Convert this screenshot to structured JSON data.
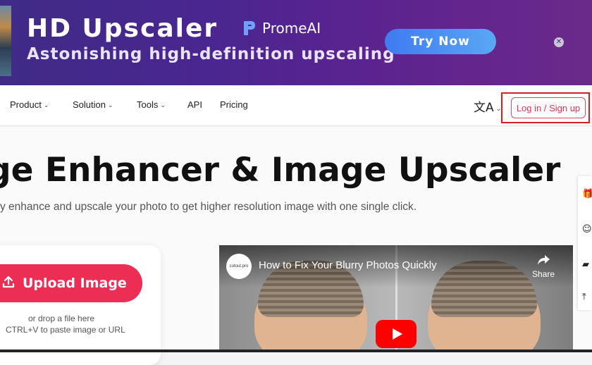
{
  "banner": {
    "title": "HD Upscaler",
    "subtitle": "Astonishing high-definition upscaling",
    "brand": "PromeAI",
    "cta": "Try Now",
    "close": "✕"
  },
  "nav": {
    "items": [
      {
        "label": "Product",
        "has_dropdown": true
      },
      {
        "label": "Solution",
        "has_dropdown": true
      },
      {
        "label": "Tools",
        "has_dropdown": true
      },
      {
        "label": "API",
        "has_dropdown": false
      },
      {
        "label": "Pricing",
        "has_dropdown": false
      }
    ],
    "language_icon": "文A",
    "login_label": "Log in / Sign up"
  },
  "hero": {
    "title": "ge Enhancer & Image Upscaler",
    "subtitle": "y enhance and upscale your photo to get higher resolution image with one single click."
  },
  "upload": {
    "button_label": "Upload Image",
    "drop_line1": "or drop a file here",
    "drop_line2": "CTRL+V to paste image or URL"
  },
  "video": {
    "channel": "cutout.pro",
    "title": "How to Fix Your Blurry Photos Quickly",
    "share_label": "Share"
  },
  "side_tools": [
    "gift-icon",
    "face-icon",
    "chat-icon",
    "top-icon"
  ],
  "colors": {
    "accent": "#ec2e55",
    "banner_start": "#3f2b86",
    "banner_end": "#6a2a8a",
    "cta": "#4a90f2",
    "login_highlight": "#d92020"
  }
}
